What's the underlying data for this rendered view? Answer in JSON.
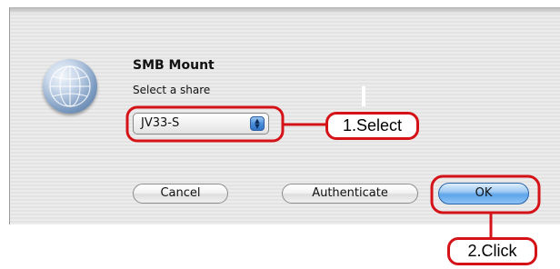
{
  "dialog": {
    "title": "SMB Mount",
    "prompt": "Select a share",
    "share_popup": {
      "selected": "JV33-S"
    },
    "buttons": {
      "cancel": "Cancel",
      "authenticate": "Authenticate",
      "ok": "OK"
    },
    "icon": "network-globe-icon"
  },
  "annotations": {
    "step1": "1.Select",
    "step2": "2.Click",
    "highlight_color": "#d41217"
  },
  "colors": {
    "default_button": "#5ea5ea",
    "stepper": "#4b8ed9"
  }
}
